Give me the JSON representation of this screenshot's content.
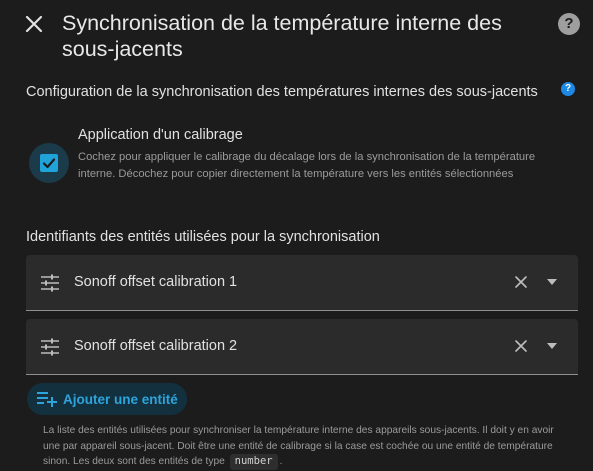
{
  "dialog": {
    "title": "Synchronisation de la température interne des sous-jacents",
    "help_glyph": "?"
  },
  "config": {
    "section_title": "Configuration de la synchronisation des températures internes des sous-jacents",
    "info_glyph": "?",
    "calibration": {
      "checked": true,
      "label": "Application d'un calibrage",
      "description": "Cochez pour appliquer le calibrage du décalage lors de la synchronisation de la température interne. Décochez pour copier directement la température vers les entités sélectionnées"
    }
  },
  "entities": {
    "section_title": "Identifiants des entités utilisées pour la synchronisation",
    "items": [
      {
        "label": "Sonoff offset calibration 1",
        "icon": "tune-icon"
      },
      {
        "label": "Sonoff offset calibration 2",
        "icon": "tune-icon"
      }
    ],
    "add_label": "Ajouter une entité",
    "help_text_before": "La liste des entités utilisées pour synchroniser la température interne des appareils sous-jacents. Il doit y en avoir une par appareil sous-jacent. Doit être une entité de calibrage si la case est cochée ou une entité de température sinon. Les deux sont des entités de type",
    "help_text_code": "number",
    "help_text_after": "."
  },
  "colors": {
    "background": "#1c1c1c",
    "accent": "#1fa3d8",
    "field_bg": "#2b2b2b",
    "info_blue": "#1e88e5"
  }
}
